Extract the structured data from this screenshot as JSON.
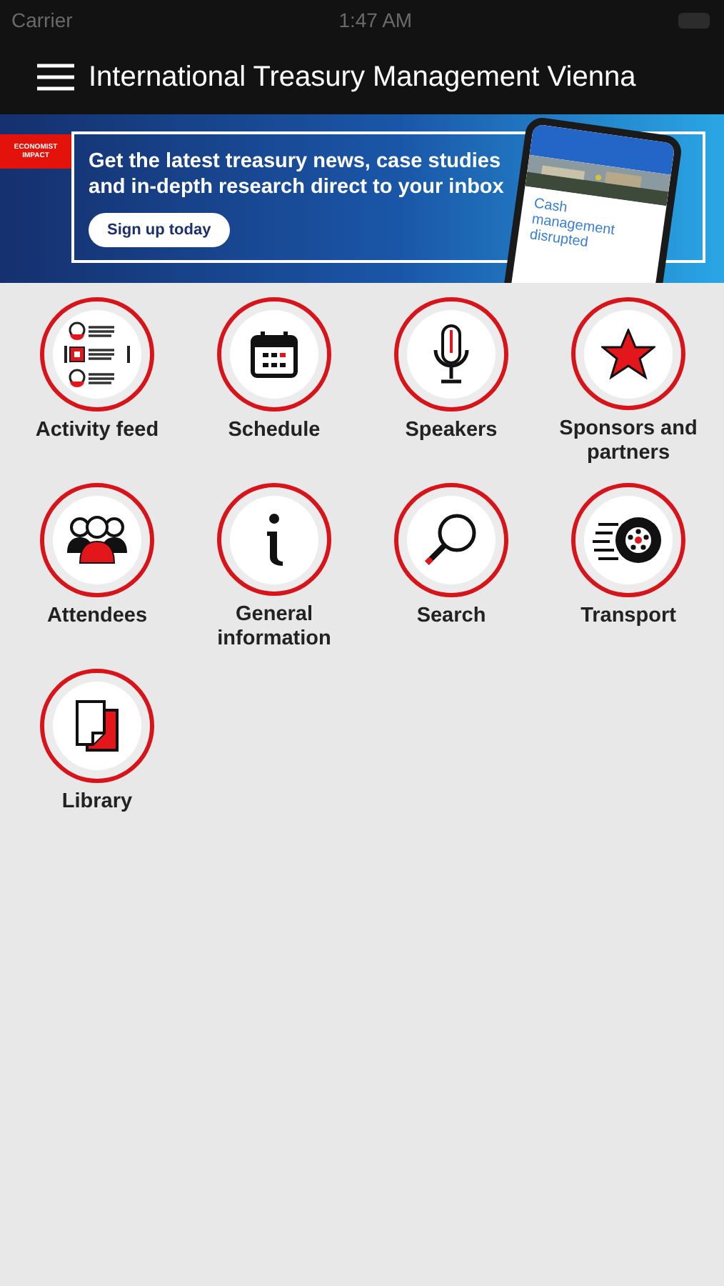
{
  "status_bar": {
    "carrier": "Carrier",
    "time": "1:47 AM"
  },
  "nav_bar": {
    "title": "International Treasury Management Vienna"
  },
  "banner": {
    "brand": "ECONOMIST IMPACT",
    "headline": "Get the latest treasury news, case studies and in-depth research direct to your inbox",
    "button": "Sign up today",
    "phone_headline": "Cash management disrupted"
  },
  "tiles": [
    {
      "label": "Activity feed"
    },
    {
      "label": "Schedule"
    },
    {
      "label": "Speakers"
    },
    {
      "label": "Sponsors and partners"
    },
    {
      "label": "Attendees"
    },
    {
      "label": "General information"
    },
    {
      "label": "Search"
    },
    {
      "label": "Transport"
    },
    {
      "label": "Library"
    }
  ]
}
